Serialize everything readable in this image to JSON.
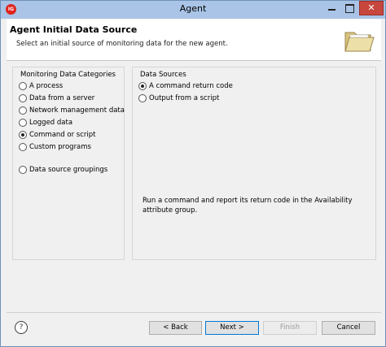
{
  "window": {
    "title": "Agent",
    "app_icon_label": "IG",
    "minimize_icon": "minimize-icon",
    "maximize_icon": "maximize-icon",
    "close_symbol": "✕"
  },
  "header": {
    "title": "Agent Initial Data Source",
    "description": "Select an initial source of monitoring data for the new agent.",
    "icon": "open-folder-icon"
  },
  "categories": {
    "title": "Monitoring Data Categories",
    "items": [
      {
        "label": "A process",
        "selected": false
      },
      {
        "label": "Data from a server",
        "selected": false
      },
      {
        "label": "Network management data",
        "selected": false
      },
      {
        "label": "Logged data",
        "selected": false
      },
      {
        "label": "Command or script",
        "selected": true
      },
      {
        "label": "Custom programs",
        "selected": false
      },
      {
        "label": "Data source groupings",
        "selected": false
      }
    ]
  },
  "sources": {
    "title": "Data Sources",
    "items": [
      {
        "label": "A command return code",
        "selected": true
      },
      {
        "label": "Output from a script",
        "selected": false
      }
    ],
    "description": "Run a command and report its return code in the Availability attribute group."
  },
  "footer": {
    "help_symbol": "?",
    "back_label": "< Back",
    "next_label": "Next >",
    "finish_label": "Finish",
    "cancel_label": "Cancel",
    "finish_enabled": false
  }
}
